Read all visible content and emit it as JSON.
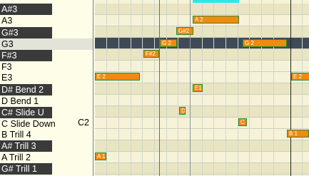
{
  "keys": [
    {
      "label": "A#3",
      "type": "black"
    },
    {
      "label": "A3",
      "type": "white"
    },
    {
      "label": "G#3",
      "type": "black"
    },
    {
      "label": "G3",
      "type": "white-selected"
    },
    {
      "label": "F#3",
      "type": "black"
    },
    {
      "label": "F3",
      "type": "white"
    },
    {
      "label": "E3",
      "type": "white"
    },
    {
      "label": "D# Bend 2",
      "type": "black"
    },
    {
      "label": "D Bend 1",
      "type": "white"
    },
    {
      "label": "C# Slide U",
      "type": "black"
    },
    {
      "label": "C Slide Down",
      "type": "white"
    },
    {
      "label": "B Trill 4",
      "type": "white"
    },
    {
      "label": "A# Trill 3",
      "type": "black"
    },
    {
      "label": "A Trill 2",
      "type": "white"
    },
    {
      "label": "G# Trill 1",
      "type": "black"
    }
  ],
  "octave_label": "C2",
  "notes": [
    {
      "label": "A 2"
    },
    {
      "label": "G#2"
    },
    {
      "label": "G 2"
    },
    {
      "label": "G 2"
    },
    {
      "label": "F#2"
    },
    {
      "label": "E 2"
    },
    {
      "label": "E 2"
    },
    {
      "label": "E1"
    },
    {
      "label": "D"
    },
    {
      "label": "C"
    },
    {
      "label": "B 1"
    },
    {
      "label": "A 1"
    }
  ],
  "colors": {
    "note_fill": "#f08a10",
    "note_border": "#2e8a2e",
    "selected_row": "#3f4957",
    "playhead": "#d04040",
    "loop_marker": "#2ee6e6"
  }
}
